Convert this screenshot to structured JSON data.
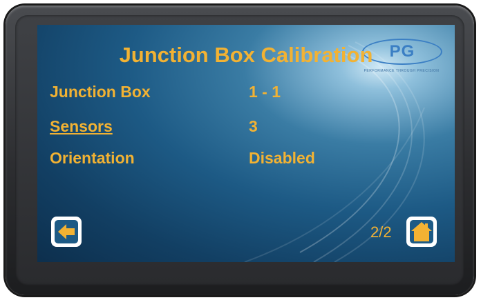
{
  "screen": {
    "title": "Junction Box Calibration",
    "logo_text": "PG",
    "logo_tagline": "PERFORMANCE THROUGH PRECISION"
  },
  "rows": [
    {
      "label": "Junction Box",
      "value": "1 - 1",
      "is_link": false
    },
    {
      "label": "Sensors",
      "value": "3",
      "is_link": true
    },
    {
      "label": "Orientation",
      "value": "Disabled",
      "is_link": false
    }
  ],
  "nav": {
    "back_icon": "arrow-left-icon",
    "home_icon": "home-icon",
    "page_indicator": "2/2"
  },
  "colors": {
    "text_accent": "#f2b233",
    "screen_blue": "#1d5a85",
    "button_bg": "#ffffff"
  }
}
